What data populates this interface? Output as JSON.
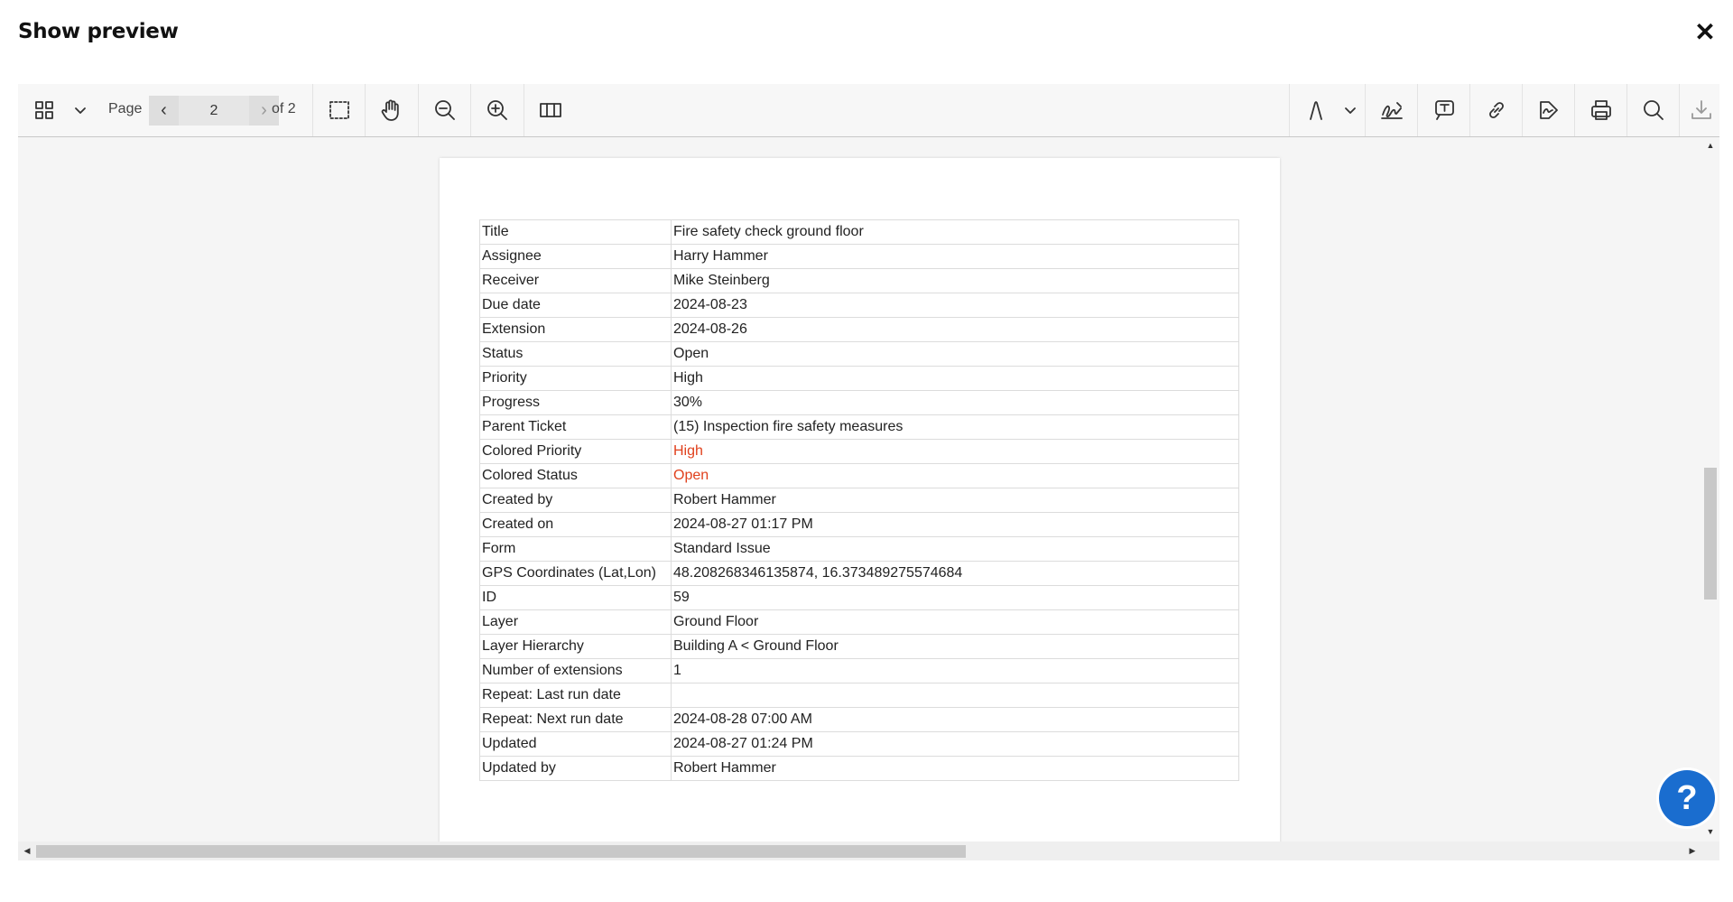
{
  "dialog": {
    "title": "Show preview",
    "close_symbol": "✕"
  },
  "toolbar": {
    "page_label": "Page",
    "current_page": "2",
    "total_pages_label": "of 2",
    "prev_symbol": "‹",
    "next_symbol": "›",
    "icons": [
      "thumbnails-icon",
      "chevron-down-icon",
      "select-area-icon",
      "pan-hand-icon",
      "zoom-out-icon",
      "zoom-in-icon",
      "two-page-view-icon",
      "draw-icon",
      "chevron-down-icon",
      "signature-icon",
      "text-comment-icon",
      "link-icon",
      "sign-flow-icon",
      "print-icon",
      "search-icon",
      "download-icon"
    ]
  },
  "properties": [
    {
      "key": "Title",
      "value": "Fire safety check ground floor"
    },
    {
      "key": "Assignee",
      "value": "Harry Hammer"
    },
    {
      "key": "Receiver",
      "value": "Mike Steinberg"
    },
    {
      "key": "Due date",
      "value": "2024-08-23"
    },
    {
      "key": "Extension",
      "value": "2024-08-26"
    },
    {
      "key": "Status",
      "value": "Open"
    },
    {
      "key": "Priority",
      "value": "High"
    },
    {
      "key": "Progress",
      "value": "30%"
    },
    {
      "key": "Parent Ticket",
      "value": "(15) Inspection fire safety measures"
    },
    {
      "key": "Colored Priority",
      "value": "High",
      "color": "#e0401c"
    },
    {
      "key": "Colored Status",
      "value": "Open",
      "color": "#e0401c"
    },
    {
      "key": "Created by",
      "value": "Robert Hammer"
    },
    {
      "key": "Created on",
      "value": "2024-08-27 01:17 PM"
    },
    {
      "key": "Form",
      "value": "Standard Issue"
    },
    {
      "key": "GPS Coordinates (Lat,Lon)",
      "value": "48.208268346135874, 16.373489275574684"
    },
    {
      "key": "ID",
      "value": "59"
    },
    {
      "key": "Layer",
      "value": "Ground Floor"
    },
    {
      "key": "Layer Hierarchy",
      "value": "Building A < Ground Floor"
    },
    {
      "key": "Number of extensions",
      "value": "1"
    },
    {
      "key": "Repeat: Last run date",
      "value": ""
    },
    {
      "key": "Repeat: Next run date",
      "value": "2024-08-28 07:00 AM"
    },
    {
      "key": "Updated",
      "value": "2024-08-27 01:24 PM"
    },
    {
      "key": "Updated by",
      "value": "Robert Hammer"
    }
  ],
  "help_button": {
    "label": "?"
  },
  "colors": {
    "accent": "#1a6dcf",
    "highlight": "#e0401c"
  }
}
